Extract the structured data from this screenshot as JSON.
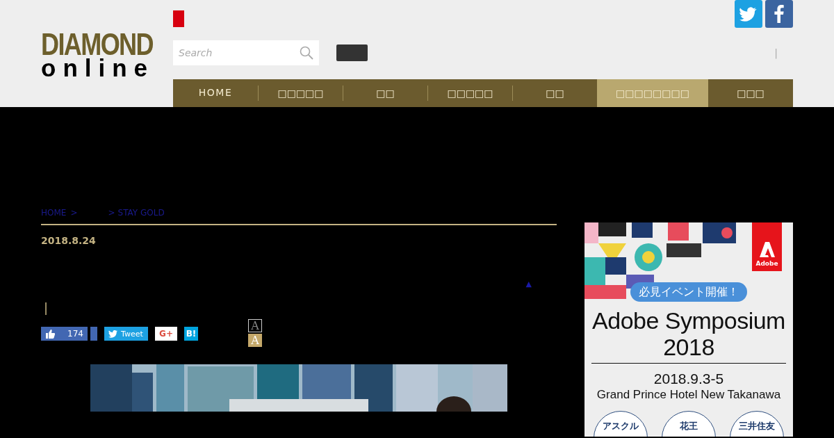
{
  "header": {
    "logo": {
      "line_1": "DIAMOND",
      "line_2": "online"
    },
    "search": {
      "placeholder": "Search"
    },
    "separator": "|"
  },
  "nav": [
    {
      "label": "HOME",
      "selected": false
    },
    {
      "label": "□□□□□",
      "selected": false
    },
    {
      "label": "□□",
      "selected": false
    },
    {
      "label": "□□□□□",
      "selected": false
    },
    {
      "label": "□□",
      "selected": false
    },
    {
      "label": "□□□□□□□□",
      "selected": true
    },
    {
      "label": "□□□",
      "selected": false
    }
  ],
  "breadcrumb": [
    {
      "label": "HOME",
      "kind": "link"
    },
    {
      "label": ">",
      "kind": "sep"
    },
    {
      "label": ">",
      "kind": "sep"
    },
    {
      "label": "STAY GOLD",
      "kind": "link"
    }
  ],
  "article": {
    "date": "2018.8.24",
    "marker": "▲",
    "bar": "|",
    "share": [
      {
        "kind": "like",
        "count": "174"
      },
      {
        "kind": "tweet",
        "label": "Tweet"
      },
      {
        "kind": "gplus",
        "label": "G+"
      },
      {
        "kind": "hatena",
        "label": "B!"
      }
    ],
    "font_sizes": [
      {
        "label": "A",
        "selected": false
      },
      {
        "label": "A",
        "selected": true
      }
    ]
  },
  "ad": {
    "logo": "Adobe",
    "badge": "必見イベント開催！",
    "title": "Adobe Symposium 2018",
    "dates": "2018.9.3-5",
    "venue": "Grand Prince Hotel New Takanawa",
    "sponsors": [
      "アスクル",
      "花王",
      "三井住友"
    ]
  }
}
